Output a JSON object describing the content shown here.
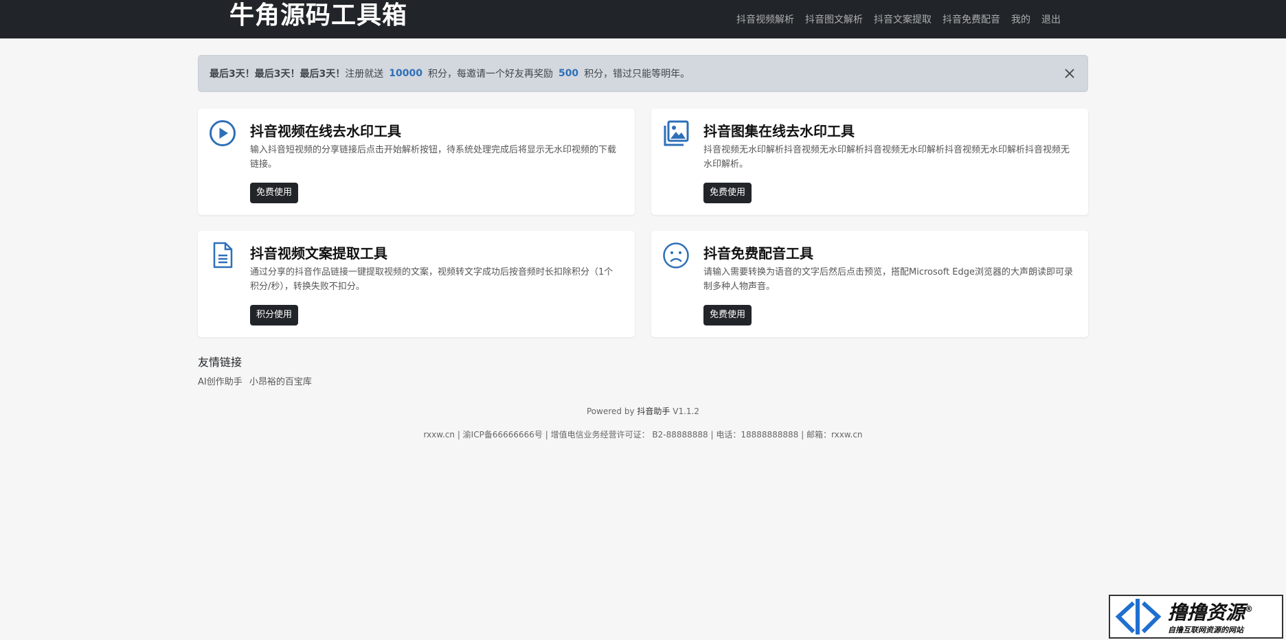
{
  "brand": "牛角源码工具箱",
  "nav": [
    "抖音视频解析",
    "抖音图文解析",
    "抖音文案提取",
    "抖音免费配音",
    "我的",
    "退出"
  ],
  "alert": {
    "strong": "最后3天！最后3天！最后3天！",
    "t1": "注册就送",
    "n1": "10000",
    "t2": "积分，每邀请一个好友再奖励",
    "n2": "500",
    "t3": "积分，错过只能等明年。"
  },
  "cards": [
    {
      "title": "抖音视频在线去水印工具",
      "desc": "输入抖音短视频的分享链接后点击开始解析按钮，待系统处理完成后将显示无水印视频的下载链接。",
      "button": "免费使用",
      "icon": "play-circle-icon"
    },
    {
      "title": "抖音图集在线去水印工具",
      "desc": "抖音视频无水印解析抖音视频无水印解析抖音视频无水印解析抖音视频无水印解析抖音视频无水印解析。",
      "button": "免费使用",
      "icon": "images-icon"
    },
    {
      "title": "抖音视频文案提取工具",
      "desc": "通过分享的抖音作品链接一键提取视频的文案，视频转文字成功后按音频时长扣除积分（1个积分/秒），转换失败不扣分。",
      "button": "积分使用",
      "icon": "file-text-icon"
    },
    {
      "title": "抖音免费配音工具",
      "desc": "请输入需要转换为语音的文字后然后点击预览，搭配Microsoft Edge浏览器的大声朗读即可录制多种人物声音。",
      "button": "免费使用",
      "icon": "frown-face-icon"
    }
  ],
  "links": {
    "title": "友情链接",
    "items": [
      "AI创作助手",
      "小昂裕的百宝库"
    ]
  },
  "footer": {
    "powered_prefix": "Powered by",
    "powered_app": "抖音助手",
    "version": "V1.1.2",
    "beian": "rxxw.cn | 渝ICP备66666666号 | 增值电信业务经营许可证： B2-88888888 | 电话：18888888888 | 邮箱：rxxw.cn"
  },
  "watermark": {
    "main": "撸撸资源",
    "reg": "®",
    "sub": "自撸互联网资源的网站"
  },
  "colors": {
    "navbar": "#212529",
    "accent": "#2d6fb8",
    "alert_bg": "#d3d7de"
  }
}
